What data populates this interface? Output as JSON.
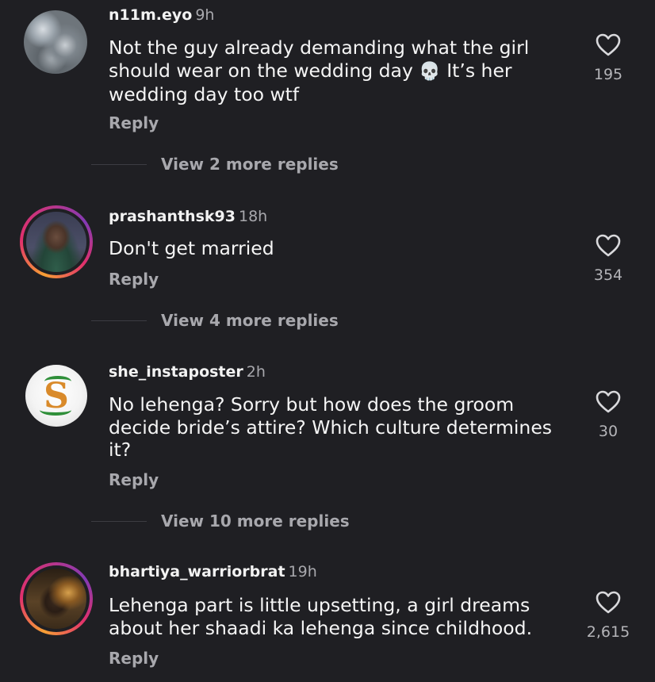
{
  "comments": [
    {
      "username": "n11m.eyo",
      "time": "9h",
      "text_parts": [
        "Not the guy already demanding what the girl should wear on the wedding day ",
        "💀",
        " It’s her wedding day too wtf"
      ],
      "reply_label": "Reply",
      "likes": "195",
      "view_more": "View 2 more replies"
    },
    {
      "username": "prashanthsk93",
      "time": "18h",
      "text": "Don't get married",
      "reply_label": "Reply",
      "likes": "354",
      "view_more": "View 4 more replies"
    },
    {
      "username": "she_instaposter",
      "time": "2h",
      "text": "No lehenga? Sorry but how does the groom decide bride’s attire? Which culture determines it?",
      "reply_label": "Reply",
      "likes": "30",
      "view_more": "View 10 more replies"
    },
    {
      "username": "bhartiya_warriorbrat",
      "time": "19h",
      "text": "Lehenga part is little upsetting, a girl dreams about her shaadi ka lehenga since childhood.",
      "reply_label": "Reply",
      "likes": "2,615"
    }
  ],
  "icons": {
    "like": "heart-outline-icon",
    "skull": "skull-emoji"
  },
  "colors": {
    "background": "#1f1f23",
    "primary_text": "#f5f5f5",
    "secondary_text": "#a8a8ad"
  }
}
